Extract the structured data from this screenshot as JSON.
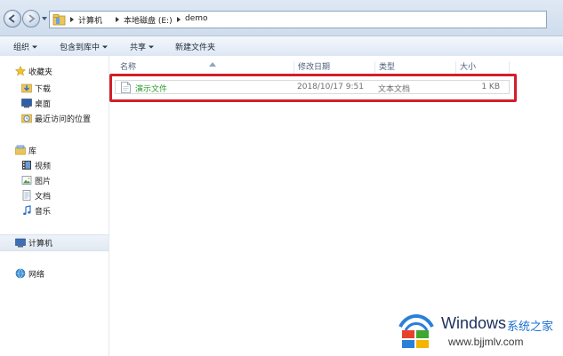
{
  "address": {
    "crumbs": [
      "计算机",
      "本地磁盘 (E:)",
      "demo"
    ]
  },
  "toolbar": {
    "organize": "组织",
    "include_in_library": "包含到库中",
    "share": "共享",
    "new_folder": "新建文件夹"
  },
  "nav": {
    "favorites": "收藏夹",
    "downloads": "下载",
    "desktop": "桌面",
    "recent": "最近访问的位置",
    "libraries": "库",
    "videos": "视频",
    "pictures": "图片",
    "documents": "文档",
    "music": "音乐",
    "computer": "计算机",
    "network": "网络"
  },
  "columns": {
    "name": "名称",
    "modified": "修改日期",
    "type": "类型",
    "size": "大小"
  },
  "files": [
    {
      "name": "演示文件",
      "modified": "2018/10/17 9:51",
      "type": "文本文档",
      "size": "1 KB"
    }
  ],
  "watermark": {
    "brand": "Windows",
    "brand_cn": "系统之家",
    "url": "www.bjjmlv.com"
  },
  "colors": {
    "highlight": "#d21f2a",
    "file_name": "#2e9a2e",
    "address_bar": "#dfe9f5"
  }
}
